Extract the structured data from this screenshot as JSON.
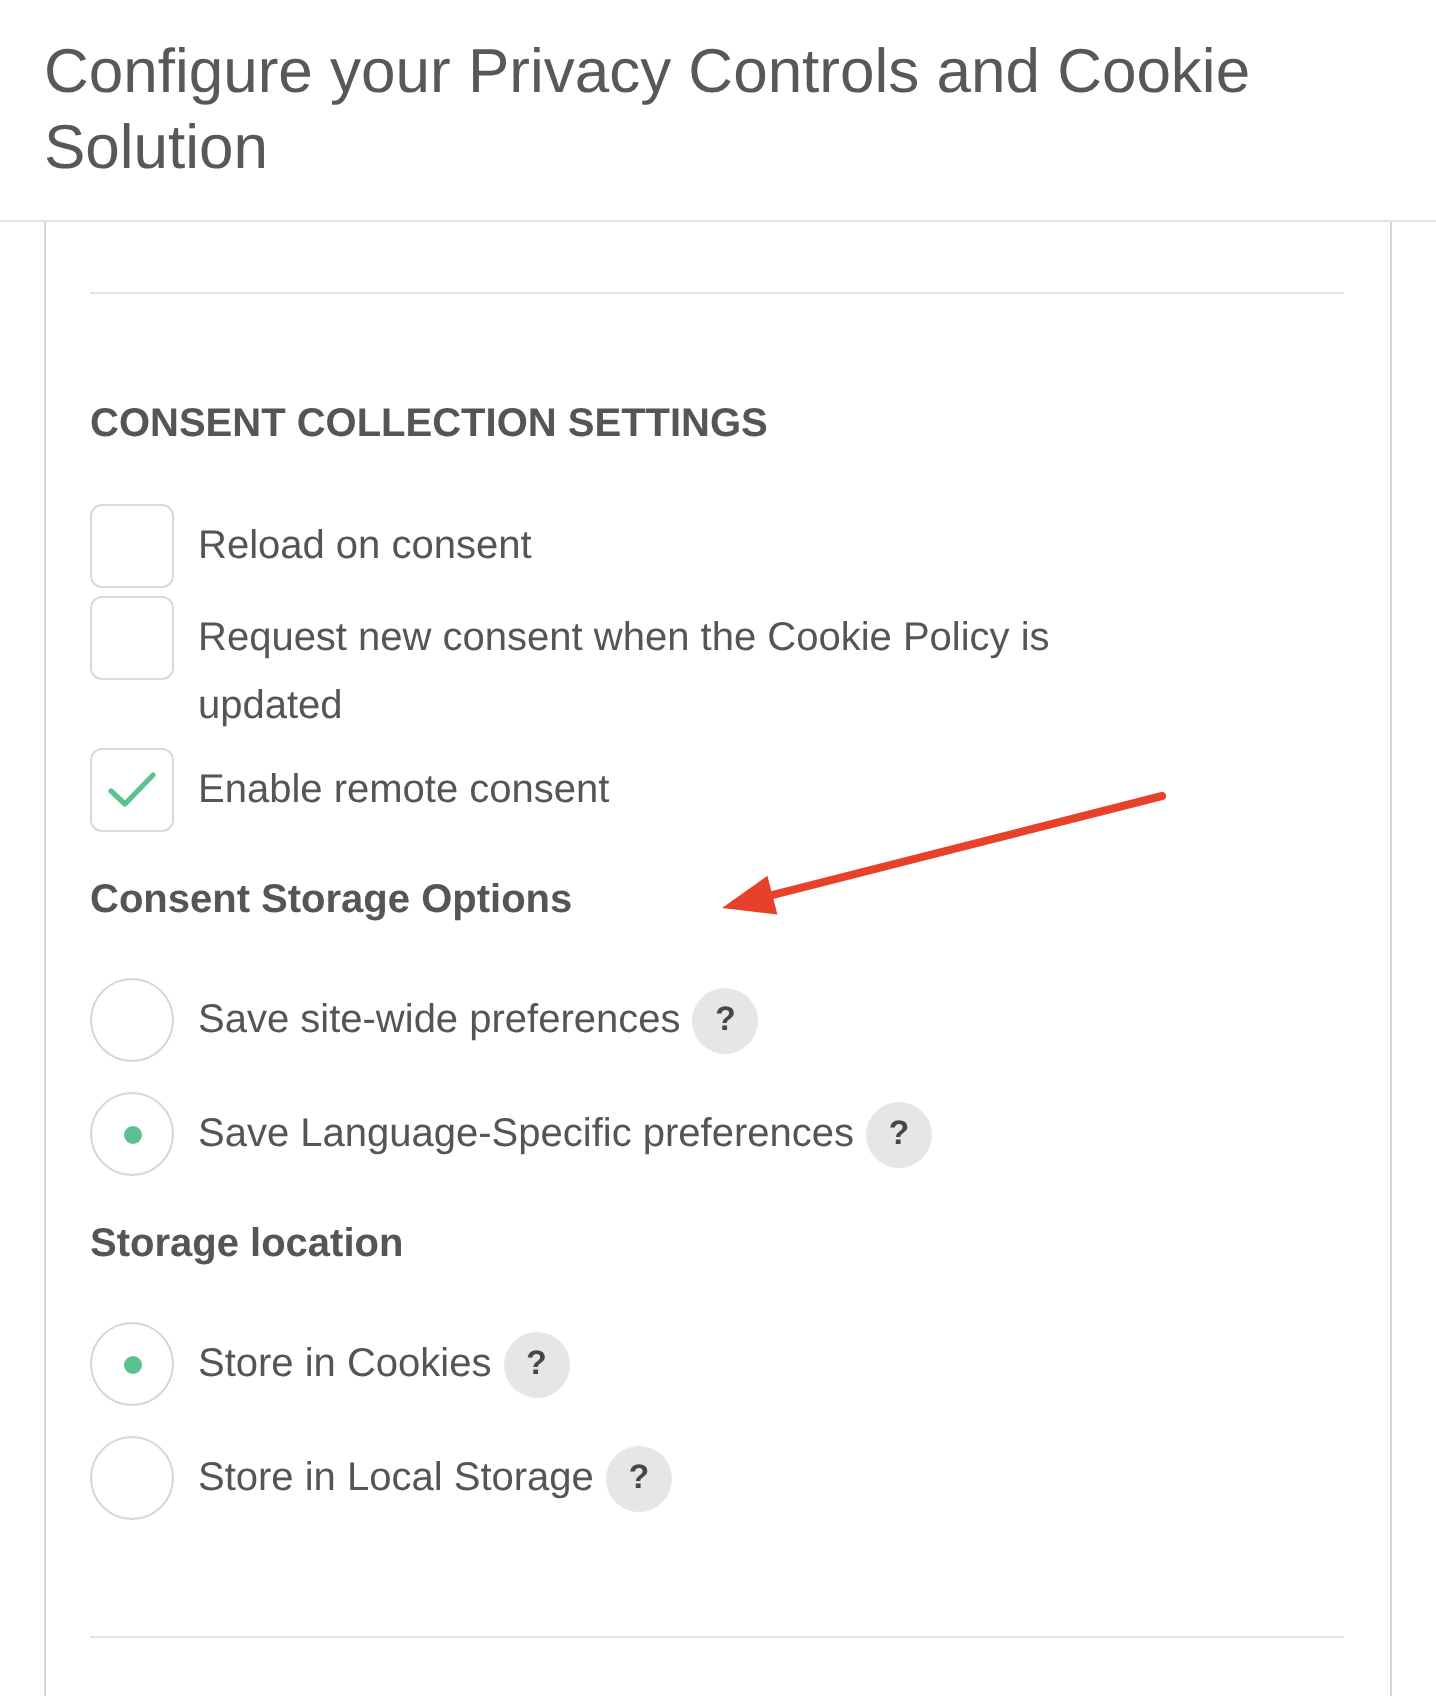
{
  "header": {
    "title": "Configure your Privacy Controls and Cookie Solution"
  },
  "consent_collection": {
    "title": "CONSENT COLLECTION SETTINGS",
    "options": [
      {
        "label": "Reload on consent",
        "checked": false
      },
      {
        "label": "Request new consent when the Cookie Policy is updated",
        "checked": false
      },
      {
        "label": "Enable remote consent",
        "checked": true
      }
    ]
  },
  "radio_groups": [
    {
      "title": "Consent Storage Options",
      "options": [
        {
          "label": "Save site-wide preferences",
          "selected": false,
          "help": "?"
        },
        {
          "label": "Save Language-Specific preferences",
          "selected": true,
          "help": "?"
        }
      ]
    },
    {
      "title": "Storage location",
      "options": [
        {
          "label": "Store in Cookies",
          "selected": true,
          "help": "?"
        },
        {
          "label": "Store in Local Storage",
          "selected": false,
          "help": "?"
        }
      ]
    }
  ]
}
